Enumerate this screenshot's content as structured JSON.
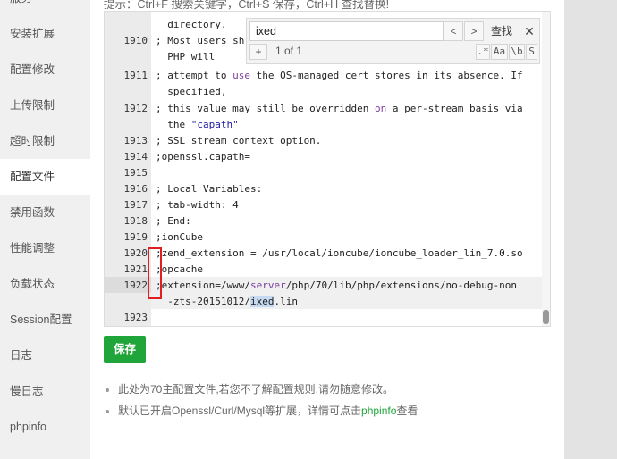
{
  "sidebar": {
    "items": [
      {
        "label": "服务"
      },
      {
        "label": "安装扩展"
      },
      {
        "label": "配置修改"
      },
      {
        "label": "上传限制"
      },
      {
        "label": "超时限制"
      },
      {
        "label": "配置文件",
        "active": true
      },
      {
        "label": "禁用函数"
      },
      {
        "label": "性能调整"
      },
      {
        "label": "负载状态"
      },
      {
        "label": "Session配置"
      },
      {
        "label": "日志"
      },
      {
        "label": "慢日志"
      },
      {
        "label": "phpinfo"
      }
    ]
  },
  "hint": "提示：Ctrl+F 搜索关键字，Ctrl+S 保存，Ctrl+H 查找替换!",
  "editor": {
    "lines": [
      {
        "num": "",
        "text": "  directory."
      },
      {
        "num": "1910",
        "text": "; Most users sh"
      },
      {
        "num": "",
        "text": "  PHP will"
      },
      {
        "num": "1911",
        "pre": "; attempt to ",
        "kw": "use",
        "post": " the OS-managed cert stores in its absence. If"
      },
      {
        "num": "",
        "text": "  specified,"
      },
      {
        "num": "1912",
        "pre": "; this value may still be overridden ",
        "kw": "on",
        "post": " a per-stream basis via"
      },
      {
        "num": "",
        "pre": "  the ",
        "str": "\"capath\"",
        "post": ""
      },
      {
        "num": "1913",
        "text": "; SSL stream context option."
      },
      {
        "num": "1914",
        "text": ";openssl.capath="
      },
      {
        "num": "1915",
        "text": ""
      },
      {
        "num": "1916",
        "text": "; Local Variables:"
      },
      {
        "num": "1917",
        "text": "; tab-width: 4"
      },
      {
        "num": "1918",
        "text": "; End:"
      },
      {
        "num": "1919",
        "text": ";ionCube"
      },
      {
        "num": "1920",
        "text": ";zend_extension = /usr/local/ioncube/ioncube_loader_lin_7.0.so"
      },
      {
        "num": "1921",
        "text": ";opcache"
      },
      {
        "num": "1922",
        "pre": ";extension=/www/",
        "kw": "server",
        "post": "/php/70/lib/php/extensions/no-debug-non"
      },
      {
        "num": "",
        "pre": "  -zts-20151012/",
        "hl": "ixed",
        "post": ".lin"
      },
      {
        "num": "1923",
        "text": ""
      }
    ]
  },
  "search": {
    "query": "ixed",
    "prev": "<",
    "next": ">",
    "find_label": "查找",
    "close": "✕",
    "plus": "+",
    "count": "1 of 1",
    "opt_regex": ".*",
    "opt_case": "Aa",
    "opt_word": "\\b",
    "opt_sel": "S"
  },
  "save_label": "保存",
  "notes": {
    "note1": "此处为70主配置文件,若您不了解配置规则,请勿随意修改。",
    "note2_pre": "默认已开启Openssl/Curl/Mysql等扩展，详情可点击",
    "note2_link": "phpinfo",
    "note2_post": "查看"
  }
}
